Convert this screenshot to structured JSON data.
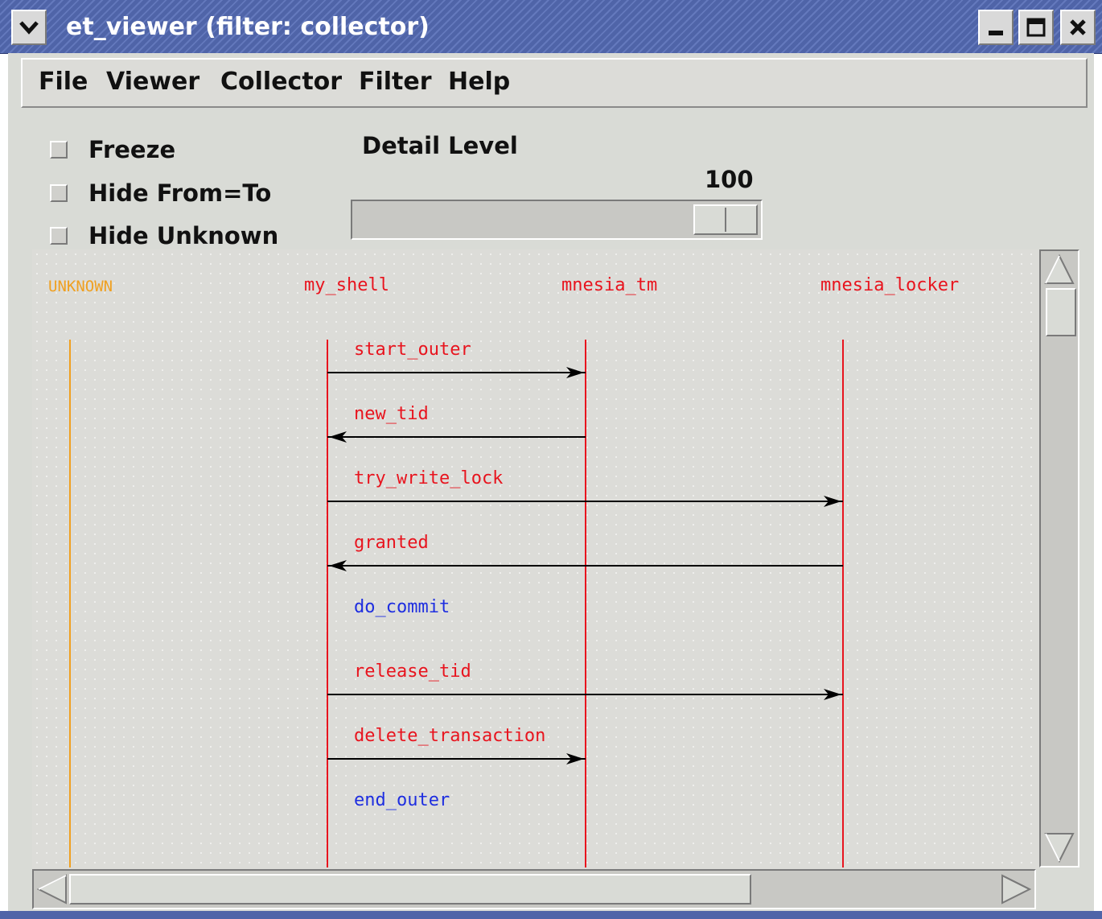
{
  "window": {
    "title": "et_viewer (filter: collector)",
    "titlebar_color": "#5066aa"
  },
  "menu": {
    "items": [
      "File",
      "Viewer",
      "Collector",
      "Filter",
      "Help"
    ]
  },
  "options": {
    "checkboxes": [
      {
        "label": "Freeze",
        "checked": false
      },
      {
        "label": "Hide From=To",
        "checked": false
      },
      {
        "label": "Hide Unknown",
        "checked": false
      }
    ]
  },
  "detail_level": {
    "label": "Detail Level",
    "value": "100",
    "fraction": 1.0
  },
  "processes": [
    {
      "name": "UNKNOWN",
      "color": "#f0a020"
    },
    {
      "name": "my_shell",
      "color": "#e8141e"
    },
    {
      "name": "mnesia_tm",
      "color": "#e8141e"
    },
    {
      "name": "mnesia_locker",
      "color": "#e8141e"
    }
  ],
  "events": [
    {
      "label": "start_outer",
      "from": "my_shell",
      "to": "mnesia_tm",
      "color": "#e8141e"
    },
    {
      "label": "new_tid",
      "from": "mnesia_tm",
      "to": "my_shell",
      "color": "#e8141e"
    },
    {
      "label": "try_write_lock",
      "from": "my_shell",
      "to": "mnesia_locker",
      "color": "#e8141e"
    },
    {
      "label": "granted",
      "from": "mnesia_locker",
      "to": "my_shell",
      "color": "#e8141e"
    },
    {
      "label": "do_commit",
      "from": "my_shell",
      "to": "my_shell",
      "color": "#1e2ee0"
    },
    {
      "label": "release_tid",
      "from": "my_shell",
      "to": "mnesia_locker",
      "color": "#e8141e"
    },
    {
      "label": "delete_transaction",
      "from": "my_shell",
      "to": "mnesia_tm",
      "color": "#e8141e"
    },
    {
      "label": "end_outer",
      "from": "my_shell",
      "to": "my_shell",
      "color": "#1e2ee0"
    }
  ]
}
